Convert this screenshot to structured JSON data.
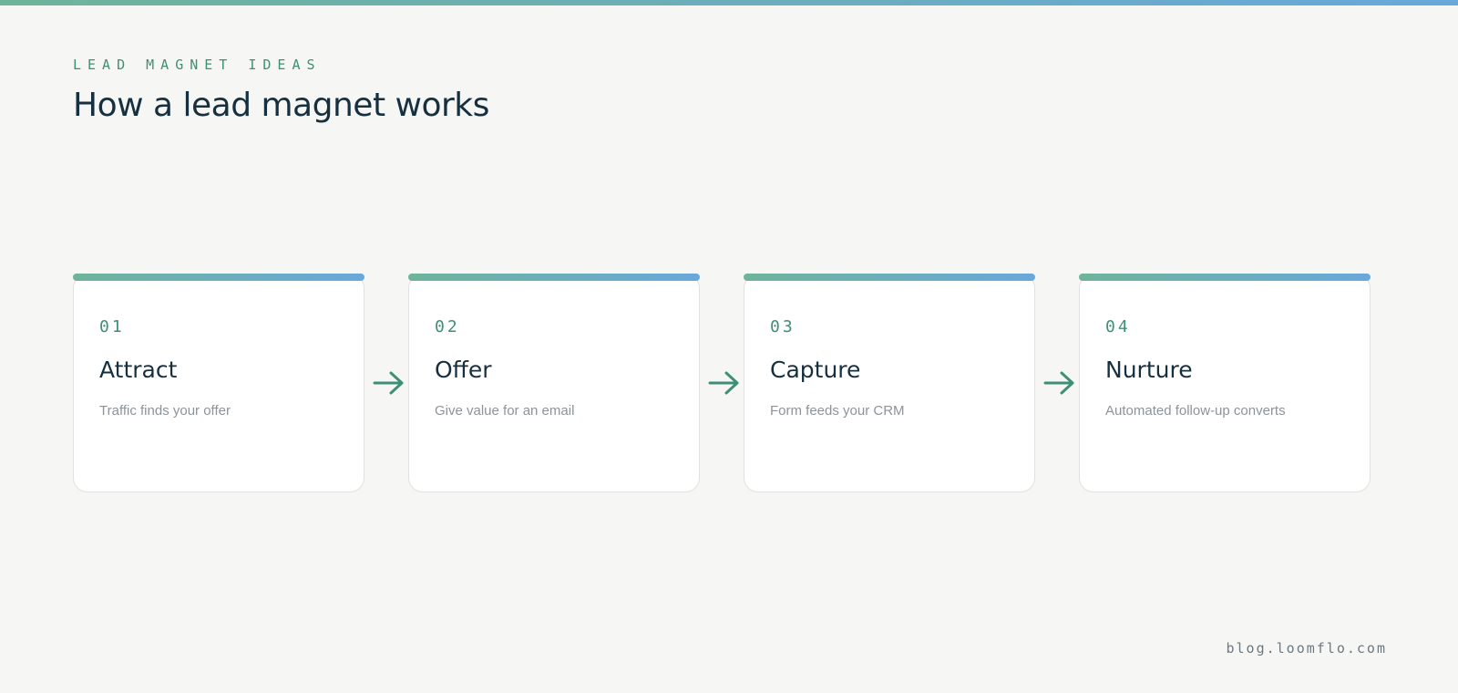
{
  "header": {
    "eyebrow": "LEAD MAGNET IDEAS",
    "title": "How a lead magnet works"
  },
  "colors": {
    "accent_green": "#3f8f78",
    "gradient_start": "#6eb49a",
    "gradient_end": "#6aa8dc",
    "heading": "#16303f",
    "muted_text": "#8b949b",
    "background": "#f6f6f4",
    "card": "#ffffff"
  },
  "steps": [
    {
      "number": "01",
      "title": "Attract",
      "description": "Traffic finds your offer"
    },
    {
      "number": "02",
      "title": "Offer",
      "description": "Give value for an email"
    },
    {
      "number": "03",
      "title": "Capture",
      "description": "Form feeds your CRM"
    },
    {
      "number": "04",
      "title": "Nurture",
      "description": "Automated follow-up converts"
    }
  ],
  "connector_icon": "arrow-right-icon",
  "footer": {
    "url": "blog.loomflo.com"
  }
}
